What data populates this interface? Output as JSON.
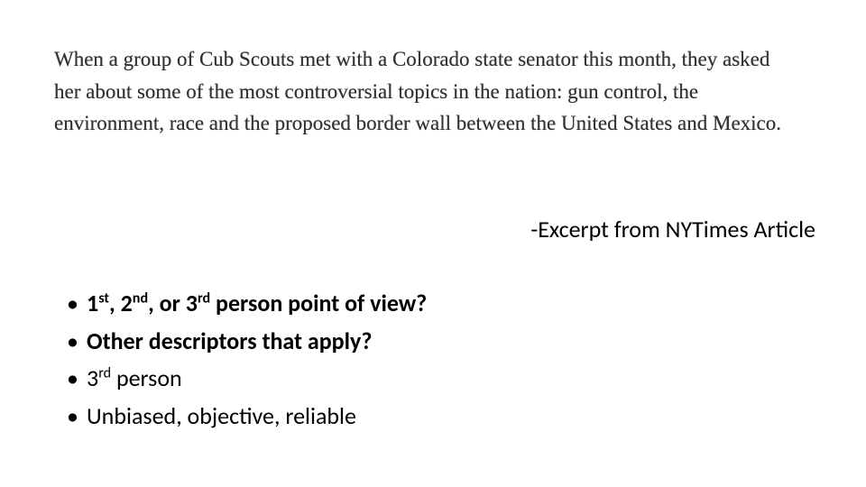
{
  "excerpt": {
    "text": "When a group of Cub Scouts met with a Colorado state senator this month, they asked her about some of the most controversial topics in the nation: gun control, the environment, race and the proposed border wall between the United States and Mexico."
  },
  "attribution": "-Excerpt from NYTimes Article",
  "bullets": {
    "items": [
      {
        "html": "1<sup>st</sup>, 2<sup>nd</sup>, or 3<sup>rd</sup> person point of view?",
        "bold": true
      },
      {
        "html": "Other descriptors that apply?",
        "bold": true
      },
      {
        "html": "3<sup>rd</sup> person",
        "bold": false
      },
      {
        "html": "Unbiased, objective, reliable",
        "bold": false
      }
    ]
  }
}
